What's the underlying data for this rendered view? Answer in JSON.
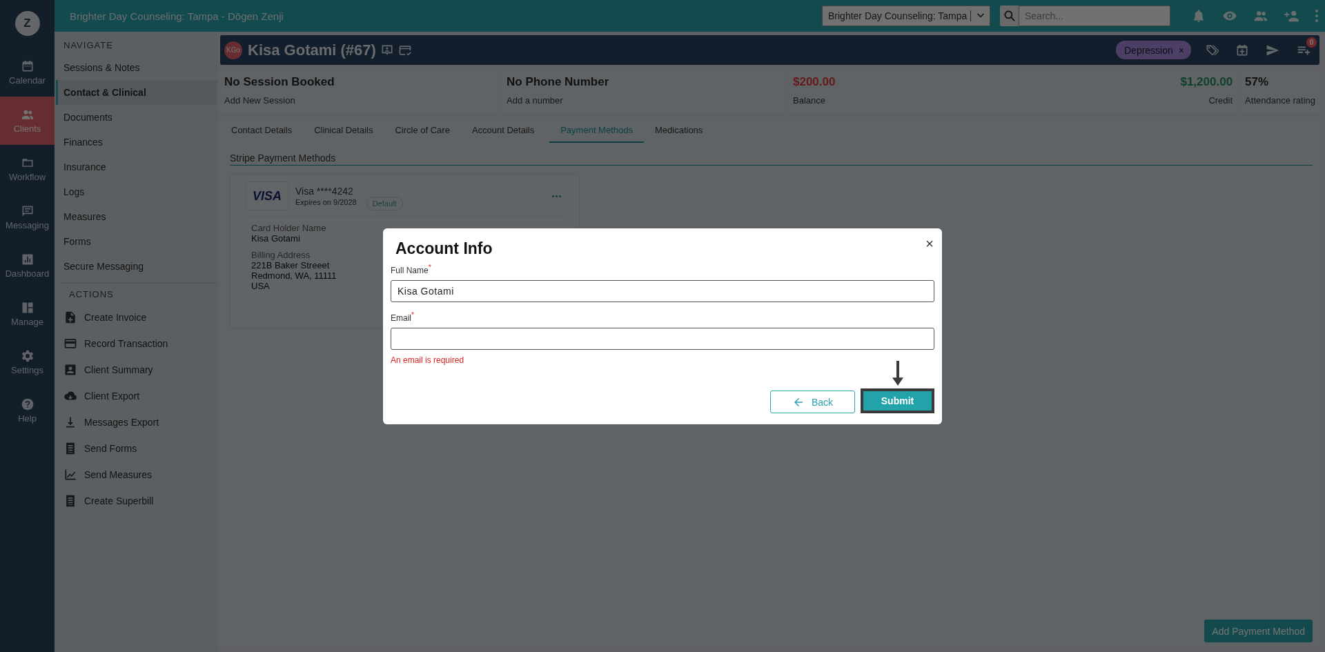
{
  "rail": {
    "avatar": "Z",
    "items": [
      {
        "label": "Calendar",
        "selected": false
      },
      {
        "label": "Clients",
        "selected": true
      },
      {
        "label": "Workflow",
        "selected": false
      },
      {
        "label": "Messaging",
        "selected": false
      },
      {
        "label": "Dashboard",
        "selected": false
      },
      {
        "label": "Manage",
        "selected": false
      },
      {
        "label": "Settings",
        "selected": false
      },
      {
        "label": "Help",
        "selected": false
      }
    ]
  },
  "topbar": {
    "title": "Brighter Day Counseling: Tampa - Dōgen Zenji",
    "location_select": "Brighter Day Counseling: Tampa",
    "search": {
      "placeholder": "Search..."
    }
  },
  "sidebar": {
    "navigate_heading": "NAVIGATE",
    "nav_items": [
      {
        "label": "Sessions & Notes",
        "selected": false
      },
      {
        "label": "Contact & Clinical",
        "selected": true
      },
      {
        "label": "Documents",
        "selected": false
      },
      {
        "label": "Finances",
        "selected": false
      },
      {
        "label": "Insurance",
        "selected": false
      },
      {
        "label": "Logs",
        "selected": false
      },
      {
        "label": "Measures",
        "selected": false
      },
      {
        "label": "Forms",
        "selected": false
      },
      {
        "label": "Secure Messaging",
        "selected": false
      }
    ],
    "actions_heading": "ACTIONS",
    "actions": [
      "Create Invoice",
      "Record Transaction",
      "Client Summary",
      "Client Export",
      "Messages Export",
      "Send Forms",
      "Send Measures",
      "Create Superbill"
    ]
  },
  "client_header": {
    "initials": "KGo",
    "name": "Kisa Gotami (#67)",
    "tag": "Depression",
    "tag_remove": "×",
    "queue_count": "0"
  },
  "stats": [
    {
      "kind": "simple",
      "value": "No Session Booked",
      "label": "Add New Session"
    },
    {
      "kind": "simple",
      "value": "No Phone Number",
      "label": "Add a number"
    },
    {
      "kind": "balance",
      "balance": "$200.00",
      "balance_label": "Balance",
      "credit": "$1,200.00",
      "credit_label": "Credit"
    },
    {
      "kind": "simple",
      "value": "57%",
      "label": "Attendance rating"
    }
  ],
  "tabs": [
    {
      "label": "Contact Details",
      "selected": false
    },
    {
      "label": "Clinical Details",
      "selected": false
    },
    {
      "label": "Circle of Care",
      "selected": false
    },
    {
      "label": "Account Details",
      "selected": false
    },
    {
      "label": "Payment Methods",
      "selected": true
    },
    {
      "label": "Medications",
      "selected": false
    }
  ],
  "payment_methods": {
    "heading": "Stripe Payment Methods",
    "cards": [
      {
        "brand": "VISA",
        "title": "Visa ****4242",
        "expires": "Expires on 9/2028",
        "badge": "Default",
        "holder_label": "Card Holder Name",
        "holder": "Kisa Gotami",
        "address_label": "Billing Address",
        "address_lines": [
          "221B Baker Streeet",
          "Redmond, WA, 11111",
          "USA"
        ]
      }
    ],
    "add_button": "Add Payment Method"
  },
  "modal": {
    "title": "Account Info",
    "close": "×",
    "fields": [
      {
        "label": "Full Name",
        "required_mark": "*",
        "value": "Kisa Gotami"
      },
      {
        "label": "Email",
        "required_mark": "*",
        "error": "An email is required"
      }
    ],
    "back_button": "Back",
    "submit_button": "Submit"
  }
}
